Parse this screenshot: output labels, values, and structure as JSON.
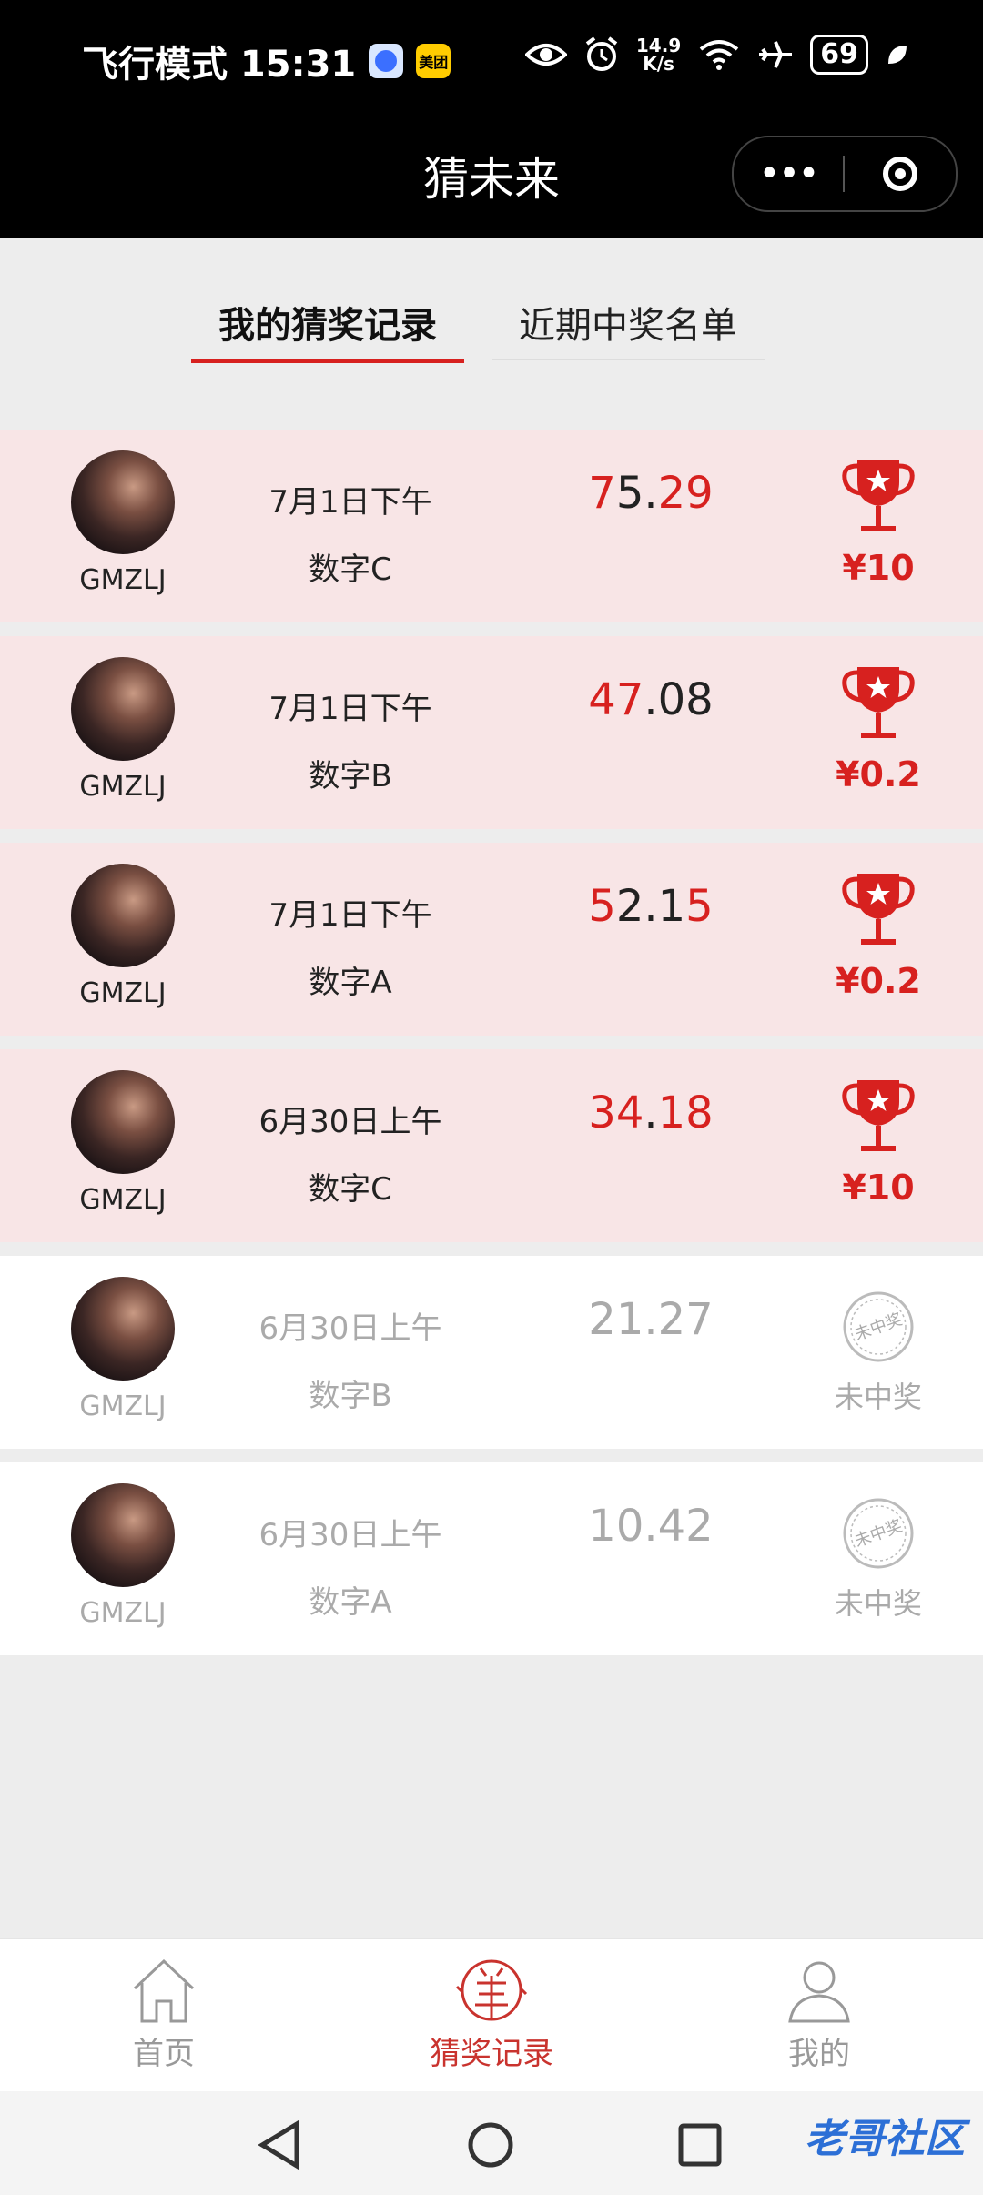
{
  "status_bar": {
    "mode_time": "飞行模式 15:31",
    "meituan_badge": "美团",
    "net_speed_value": "14.9",
    "net_speed_unit": "K/s",
    "battery": "69"
  },
  "header": {
    "title": "猜未来",
    "more_icon": "more-dots-icon",
    "target_icon": "target-icon"
  },
  "tabs": [
    {
      "label": "我的猜奖记录",
      "active": true
    },
    {
      "label": "近期中奖名单",
      "active": false
    }
  ],
  "records": [
    {
      "user": "GMZLJ",
      "date": "7月1日下午",
      "label": "数字C",
      "number_parts": [
        {
          "t": "7",
          "red": true
        },
        {
          "t": "5.",
          "red": false
        },
        {
          "t": "29",
          "red": true
        }
      ],
      "won": true,
      "prize": "¥10"
    },
    {
      "user": "GMZLJ",
      "date": "7月1日下午",
      "label": "数字B",
      "number_parts": [
        {
          "t": "47",
          "red": true
        },
        {
          "t": ".08",
          "red": false
        }
      ],
      "won": true,
      "prize": "¥0.2"
    },
    {
      "user": "GMZLJ",
      "date": "7月1日下午",
      "label": "数字A",
      "number_parts": [
        {
          "t": "5",
          "red": true
        },
        {
          "t": "2.1",
          "red": false
        },
        {
          "t": "5",
          "red": true
        }
      ],
      "won": true,
      "prize": "¥0.2"
    },
    {
      "user": "GMZLJ",
      "date": "6月30日上午",
      "label": "数字C",
      "number_parts": [
        {
          "t": "34",
          "red": true
        },
        {
          "t": ".",
          "red": false
        },
        {
          "t": "18",
          "red": true
        }
      ],
      "won": true,
      "prize": "¥10"
    },
    {
      "user": "GMZLJ",
      "date": "6月30日上午",
      "label": "数字B",
      "number_parts": [
        {
          "t": "21.27",
          "red": false
        }
      ],
      "won": false,
      "result": "未中奖",
      "stamp_text": "未中奖"
    },
    {
      "user": "GMZLJ",
      "date": "6月30日上午",
      "label": "数字A",
      "number_parts": [
        {
          "t": "10.42",
          "red": false
        }
      ],
      "won": false,
      "result": "未中奖",
      "stamp_text": "未中奖"
    }
  ],
  "bottom_nav": [
    {
      "label": "首页",
      "icon": "home-icon",
      "active": false
    },
    {
      "label": "猜奖记录",
      "icon": "yang-coin-icon",
      "active": true
    },
    {
      "label": "我的",
      "icon": "user-icon",
      "active": false
    }
  ],
  "watermark": "老哥社区",
  "colors": {
    "accent_red": "#d7211f",
    "win_row_bg": "#f8e5e6",
    "inactive_gray": "#999999"
  }
}
